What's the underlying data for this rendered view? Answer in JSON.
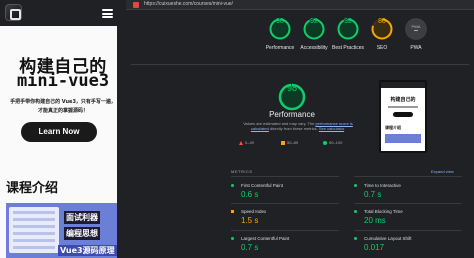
{
  "browser": {
    "url": "https://cuixueshe.com/courses/mini-vue/"
  },
  "mobile": {
    "title_line1": "构建自己的",
    "title_line2": "mini-vue3",
    "subtitle_line1": "手把手带你构建自己的 Vue3，只有手写一遍，",
    "subtitle_line2": "才能真正的掌握源码！",
    "cta_label": "Learn Now",
    "section_title": "课程介绍",
    "card_text1": "面试利器",
    "card_text2": "编程思想",
    "card_text3": "Vue3源码原理"
  },
  "scores": [
    {
      "label": "Performance",
      "value": "98",
      "score": 98,
      "color": "#0cce6b"
    },
    {
      "label": "Accessibility",
      "value": "92",
      "score": 92,
      "color": "#0cce6b"
    },
    {
      "label": "Best Practices",
      "value": "92",
      "score": 92,
      "color": "#0cce6b"
    },
    {
      "label": "SEO",
      "value": "80",
      "score": 80,
      "color": "#ffa400"
    },
    {
      "label": "PWA",
      "value": "PWA"
    }
  ],
  "performance": {
    "score": "98",
    "score_value": 98,
    "title": "Performance",
    "desc_pre": "Values are estimated and may vary. The ",
    "desc_link1": "performance score is calculated",
    "desc_mid": " directly from these metrics. ",
    "desc_link2": "See calculator",
    "desc_post": ".",
    "legend": [
      "0–49",
      "50–89",
      "90–100"
    ]
  },
  "metrics": {
    "header": "METRICS",
    "expand_label": "Expand view",
    "items": [
      {
        "label": "First Contentful Paint",
        "value": "0.6 s",
        "status": "green"
      },
      {
        "label": "Time to Interactive",
        "value": "0.7 s",
        "status": "green"
      },
      {
        "label": "Speed Index",
        "value": "1.5 s",
        "status": "orange"
      },
      {
        "label": "Total Blocking Time",
        "value": "20 ms",
        "status": "green"
      },
      {
        "label": "Largest Contentful Paint",
        "value": "0.7 s",
        "status": "green"
      },
      {
        "label": "Cumulative Layout Shift",
        "value": "0.017",
        "status": "green"
      }
    ]
  }
}
